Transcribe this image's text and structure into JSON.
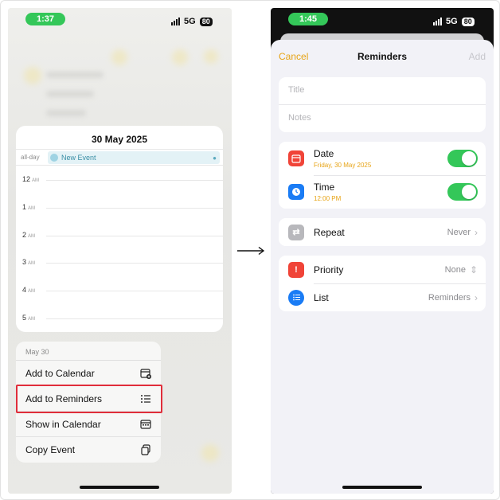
{
  "left_screen": {
    "status_time": "1:37",
    "network": "5G",
    "battery": "80",
    "calendar": {
      "date_title": "30 May 2025",
      "allday_label": "all-day",
      "event_title": "New Event",
      "hours": [
        {
          "num": "12",
          "suffix": "AM"
        },
        {
          "num": "1",
          "suffix": "AM"
        },
        {
          "num": "2",
          "suffix": "AM"
        },
        {
          "num": "3",
          "suffix": "AM"
        },
        {
          "num": "4",
          "suffix": "AM"
        },
        {
          "num": "5",
          "suffix": "AM"
        }
      ]
    },
    "context_menu": {
      "header": "May 30",
      "items": [
        {
          "label": "Add to Calendar",
          "icon": "calendar-add-icon"
        },
        {
          "label": "Add to Reminders",
          "icon": "list-icon"
        },
        {
          "label": "Show in Calendar",
          "icon": "calendar-icon"
        },
        {
          "label": "Copy Event",
          "icon": "copy-icon"
        }
      ]
    }
  },
  "right_screen": {
    "status_time": "1:45",
    "network": "5G",
    "battery": "80",
    "nav": {
      "cancel": "Cancel",
      "title": "Reminders",
      "add": "Add"
    },
    "fields": {
      "title_placeholder": "Title",
      "notes_placeholder": "Notes"
    },
    "date": {
      "label": "Date",
      "value": "Friday, 30 May 2025",
      "enabled": true
    },
    "time": {
      "label": "Time",
      "value": "12:00 PM",
      "enabled": true
    },
    "repeat": {
      "label": "Repeat",
      "value": "Never"
    },
    "priority": {
      "label": "Priority",
      "value": "None"
    },
    "list": {
      "label": "List",
      "value": "Reminders"
    }
  },
  "colors": {
    "accent": "#e7a416",
    "status_green": "#34c759",
    "highlight_red": "#e02d3a",
    "date_icon": "#f04438",
    "time_icon": "#1a7cf5",
    "repeat_icon": "#b8b8bc",
    "priority_icon": "#f04438",
    "list_icon": "#1a7cf5"
  }
}
